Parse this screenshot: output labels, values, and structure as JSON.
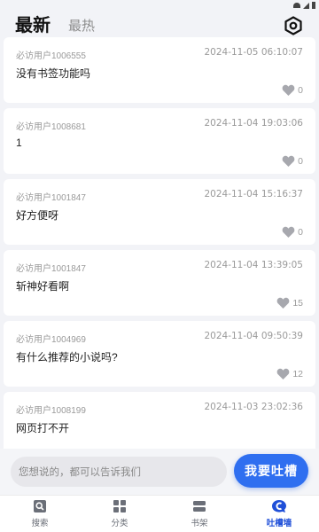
{
  "header": {
    "tab_latest": "最新",
    "tab_hot": "最热"
  },
  "posts": [
    {
      "user": "必访用户1006555",
      "time": "2024-11-05 06:10:07",
      "content": "没有书签功能吗",
      "likes": "0"
    },
    {
      "user": "必访用户1008681",
      "time": "2024-11-04 19:03:06",
      "content": "1",
      "likes": "0"
    },
    {
      "user": "必访用户1001847",
      "time": "2024-11-04 15:16:37",
      "content": "好方便呀",
      "likes": "0"
    },
    {
      "user": "必访用户1001847",
      "time": "2024-11-04 13:39:05",
      "content": "斩神好看啊",
      "likes": "15"
    },
    {
      "user": "必访用户1004969",
      "time": "2024-11-04 09:50:39",
      "content": "有什么推荐的小说吗?",
      "likes": "12"
    },
    {
      "user": "必访用户1008199",
      "time": "2024-11-03 23:02:36",
      "content": "网页打不开",
      "likes": "0"
    }
  ],
  "composer": {
    "placeholder": "您想说的，都可以告诉我们",
    "submit_label": "我要吐槽"
  },
  "tabbar": {
    "search": "搜索",
    "category": "分类",
    "bookshelf": "书架",
    "feedback": "吐槽墙"
  },
  "colors": {
    "accent": "#2f6ff0",
    "active_tab": "#1f4fd8",
    "background": "#f2f3f7"
  },
  "icons": {
    "settings": "hexagon-gear-icon",
    "like": "heart-icon",
    "search": "search-icon",
    "category": "grid-icon",
    "bookshelf": "bookshelf-icon",
    "feedback": "chat-bubble-icon"
  }
}
